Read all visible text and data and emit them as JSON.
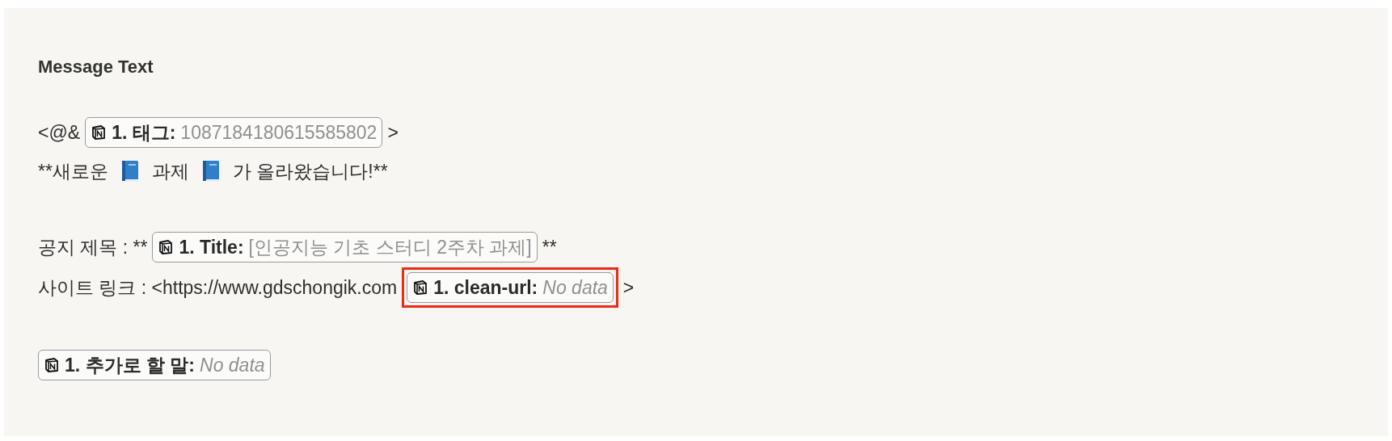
{
  "panel": {
    "title": "Message Text",
    "lines": [
      {
        "space_before": false,
        "segments": [
          {
            "kind": "text",
            "text": "<@&"
          },
          {
            "kind": "token",
            "label": "1. 태그:",
            "value": "1087184180615585802",
            "empty": false,
            "highlighted": false
          },
          {
            "kind": "text",
            "text": ">"
          }
        ]
      },
      {
        "space_before": false,
        "segments": [
          {
            "kind": "text",
            "text": "**새로운"
          },
          {
            "kind": "book"
          },
          {
            "kind": "text",
            "text": "과제"
          },
          {
            "kind": "book"
          },
          {
            "kind": "text",
            "text": "가 올라왔습니다!**"
          }
        ]
      },
      {
        "space_before": true,
        "segments": [
          {
            "kind": "text",
            "text": "공지 제목 : **"
          },
          {
            "kind": "token",
            "label": "1. Title:",
            "value": "[인공지능 기초 스터디 2주차 과제]",
            "empty": false,
            "highlighted": false
          },
          {
            "kind": "text",
            "text": "**"
          }
        ]
      },
      {
        "space_before": false,
        "segments": [
          {
            "kind": "text",
            "text": "사이트 링크 : <https://www.gdschongik.com"
          },
          {
            "kind": "token",
            "label": "1. clean-url:",
            "value": "No data",
            "empty": true,
            "highlighted": true
          },
          {
            "kind": "text",
            "text": ">"
          }
        ]
      },
      {
        "space_before": true,
        "segments": [
          {
            "kind": "token",
            "label": "1. 추가로 할 말:",
            "value": "No data",
            "empty": true,
            "highlighted": false
          }
        ]
      }
    ]
  }
}
